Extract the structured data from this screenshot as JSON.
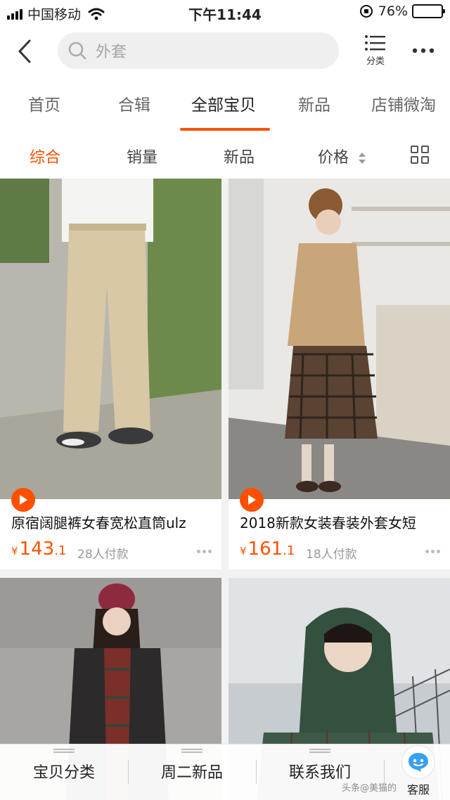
{
  "status_bar": {
    "carrier": "中国移动",
    "time": "下午11:44",
    "battery": "76%",
    "battery_level": 0.76
  },
  "header": {
    "search_placeholder": "外套",
    "category_label": "分类"
  },
  "shop_tabs": [
    {
      "label": "首页",
      "active": false
    },
    {
      "label": "合辑",
      "active": false
    },
    {
      "label": "全部宝贝",
      "active": true
    },
    {
      "label": "新品",
      "active": false
    },
    {
      "label": "店铺微淘",
      "active": false
    }
  ],
  "sort_bar": {
    "items": [
      {
        "label": "综合",
        "active": true
      },
      {
        "label": "销量",
        "active": false
      },
      {
        "label": "新品",
        "active": false
      },
      {
        "label": "价格",
        "active": false
      }
    ]
  },
  "products": [
    {
      "title": "原宿阔腿裤女春宽松直筒ulz",
      "currency": "¥",
      "price_int": "143",
      "price_dec": ".1",
      "sold": "28人付款",
      "has_video": true
    },
    {
      "title": "2018新款女装春装外套女短",
      "currency": "¥",
      "price_int": "161",
      "price_dec": ".1",
      "sold": "18人付款",
      "has_video": true
    },
    {
      "title": "",
      "has_video": false
    },
    {
      "title": "",
      "has_video": false
    }
  ],
  "bottom_bar": {
    "items": [
      {
        "label": "宝贝分类"
      },
      {
        "label": "周二新品"
      },
      {
        "label": "联系我们"
      }
    ],
    "service_label": "客服"
  },
  "watermark": "头条@美猫的"
}
